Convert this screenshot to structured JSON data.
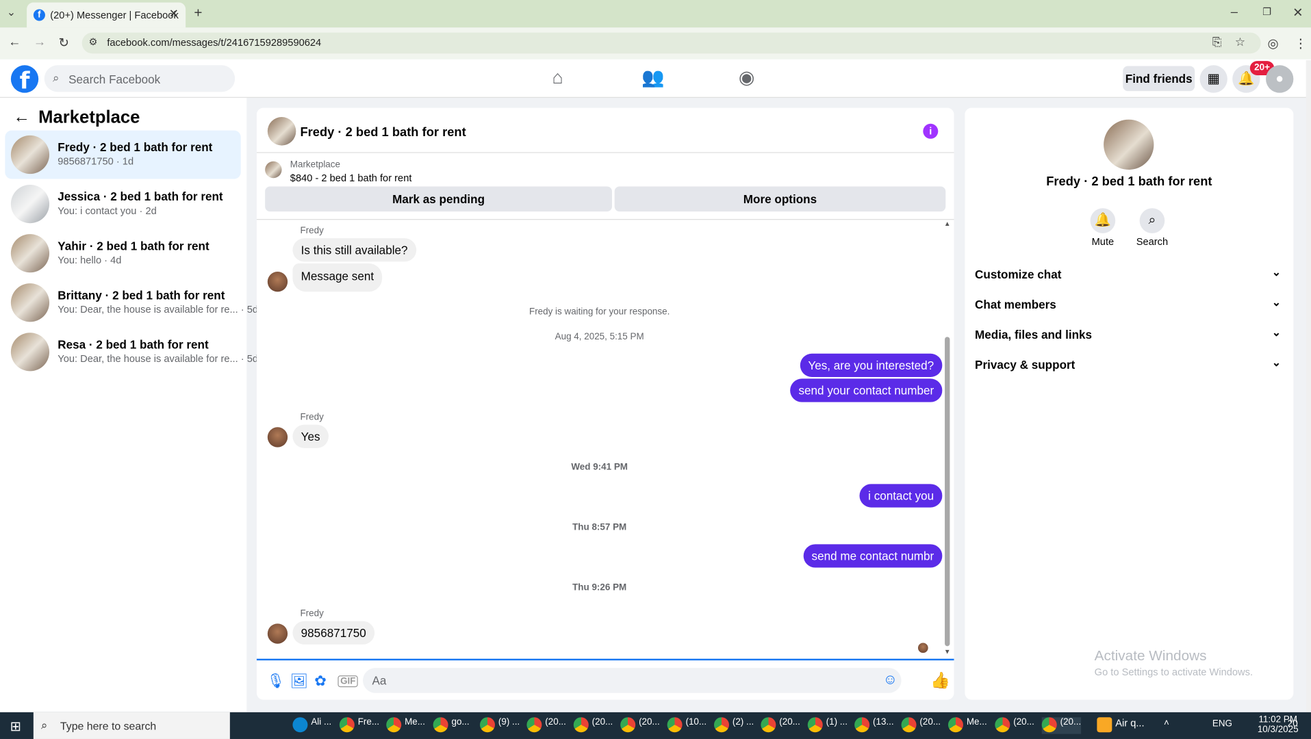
{
  "browser": {
    "tab_title": "(20+) Messenger | Facebook",
    "url": "facebook.com/messages/t/24167159289590624"
  },
  "header": {
    "search_placeholder": "Search Facebook",
    "find_friends": "Find friends",
    "notif_count": "20+"
  },
  "sidebar": {
    "title": "Marketplace",
    "conversations": [
      {
        "name": "Fredy · 2 bed 1 bath for rent",
        "preview": "9856871750 · 1d"
      },
      {
        "name": "Jessica · 2 bed 1 bath for rent",
        "preview": "You: i contact you · 2d"
      },
      {
        "name": "Yahir · 2 bed 1 bath for rent",
        "preview": "You: hello · 4d"
      },
      {
        "name": "Brittany · 2 bed 1 bath for rent",
        "preview": "You: Dear, the house is available for re... · 5d"
      },
      {
        "name": "Resa · 2 bed 1 bath for rent",
        "preview": "You: Dear, the house is available for re... · 5d"
      }
    ]
  },
  "chat": {
    "title": "Fredy · 2 bed 1 bath for rent",
    "listing_label": "Marketplace",
    "listing_desc": "$840 - 2 bed 1 bath for rent",
    "btn_pending": "Mark as pending",
    "btn_more": "More options",
    "sender": "Fredy",
    "m1": "Is this still available?",
    "m2": "Message sent",
    "waiting": "Fredy is waiting for your response.",
    "ts1": "Aug 4, 2025, 5:15 PM",
    "m3": "Yes, are you interested?",
    "m4": "send your contact number",
    "m5": "Yes",
    "ts2": "Wed 9:41 PM",
    "m6": "i contact you",
    "ts3": "Thu 8:57 PM",
    "m7": "send me contact numbr",
    "ts4": "Thu 9:26 PM",
    "m8": "9856871750",
    "composer_placeholder": "Aa"
  },
  "details": {
    "name": "Fredy · 2 bed 1 bath for rent",
    "mute": "Mute",
    "search": "Search",
    "sections": [
      "Customize chat",
      "Chat members",
      "Media, files and links",
      "Privacy & support"
    ]
  },
  "watermark": {
    "line1": "Activate Windows",
    "line2": "Go to Settings to activate Windows."
  },
  "taskbar": {
    "search": "Type here to search",
    "apps": [
      "Ali ...",
      "Fre...",
      "Me...",
      "go...",
      "(9) ...",
      "(20...",
      "(20...",
      "(20...",
      "(10...",
      "(2) ...",
      "(20...",
      "(1) ...",
      "(13...",
      "(20...",
      "Me...",
      "(20...",
      "(20...",
      "Air q..."
    ],
    "lang": "ENG",
    "time": "11:02 PM",
    "date": "10/3/2025",
    "notif": "20"
  },
  "colors": {
    "brand": "#1877f2",
    "outgoing_bubble": "#5b2be8",
    "info": "#a033ff"
  }
}
